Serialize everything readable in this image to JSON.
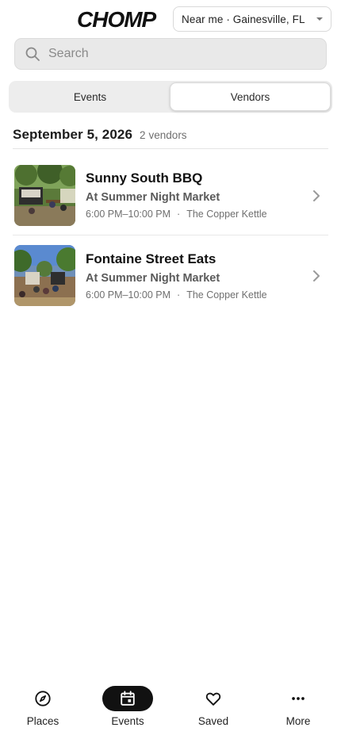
{
  "header": {
    "logo_text": "CHOMP",
    "location": "Near me · Gainesville, FL"
  },
  "search": {
    "placeholder": "Search"
  },
  "tabs": [
    {
      "label": "Events",
      "active": false
    },
    {
      "label": "Vendors",
      "active": true
    }
  ],
  "section": {
    "date": "September 5, 2026",
    "count": "2",
    "count_label": "vendors"
  },
  "vendors": [
    {
      "name": "Sunny South BBQ",
      "location": "At Summer Night Market",
      "time": "6:00 PM–10:00 PM",
      "venue": "The Copper Kettle"
    },
    {
      "name": "Fontaine Street Eats",
      "location": "At Summer Night Market",
      "time": "6:00 PM–10:00 PM",
      "venue": "The Copper Kettle"
    }
  ],
  "bottom_nav": [
    {
      "label": "Places",
      "icon": "compass-icon",
      "active": false
    },
    {
      "label": "Events",
      "icon": "calendar-icon",
      "active": true
    },
    {
      "label": "Saved",
      "icon": "heart-icon",
      "active": false
    },
    {
      "label": "More",
      "icon": "more-dots-icon",
      "active": false
    }
  ],
  "colors": {
    "accent": "#111111",
    "muted_text": "#6f6f6f",
    "segment_bg": "#ededed",
    "search_bg": "#e9e9e9"
  }
}
